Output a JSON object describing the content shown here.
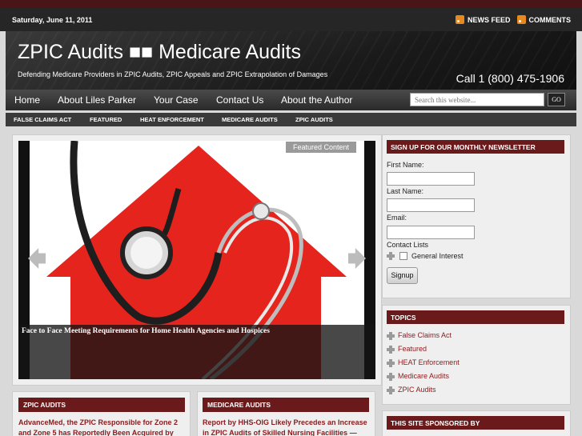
{
  "topbar": {
    "date": "Saturday, June 11, 2011",
    "links": [
      "NEWS FEED",
      "COMMENTS"
    ]
  },
  "header": {
    "title": "ZPIC Audits ■■ Medicare Audits",
    "description": "Defending Medicare Providers in ZPIC Audits, ZPIC Appeals and ZPIC Extrapolation of Damages",
    "phone": "Call 1 (800) 475-1906"
  },
  "nav": {
    "items": [
      "Home",
      "About Liles Parker",
      "Your Case",
      "Contact Us",
      "About the Author"
    ],
    "search_placeholder": "Search this website...",
    "search_button": "GO"
  },
  "subnav": {
    "items": [
      "FALSE CLAIMS ACT",
      "FEATURED",
      "HEAT ENFORCEMENT",
      "MEDICARE AUDITS",
      "ZPIC AUDITS"
    ]
  },
  "slider": {
    "badge": "Featured Content",
    "caption": "Face to Face Meeting Requirements for Home Health Agencies and Hospices"
  },
  "posts": [
    {
      "heading": "ZPIC AUDITS",
      "lines": [
        "AdvanceMed, the ZPIC Responsible for Zone 2",
        "and Zone 5 has Reportedly Been Acquired by"
      ]
    },
    {
      "heading": "MEDICARE AUDITS",
      "lines": [
        "Report by HHS-OIG Likely Precedes an Increase",
        "in ZPIC Audits of Skilled Nursing Facilities —"
      ]
    }
  ],
  "newsletter": {
    "heading": "SIGN UP FOR OUR MONTHLY NEWSLETTER",
    "first_name": "First Name:",
    "last_name": "Last Name:",
    "email": "Email:",
    "contact_lists": "Contact Lists",
    "list_option": "General Interest",
    "button": "Signup"
  },
  "topics": {
    "heading": "TOPICS",
    "items": [
      "False Claims Act",
      "Featured",
      "HEAT Enforcement",
      "Medicare Audits",
      "ZPIC Audits"
    ]
  },
  "sponsor": {
    "heading": "THIS SITE SPONSORED BY"
  },
  "colors": {
    "accent": "#6b1a1c",
    "link": "#8b1a1c",
    "rss": "#e8891f"
  }
}
